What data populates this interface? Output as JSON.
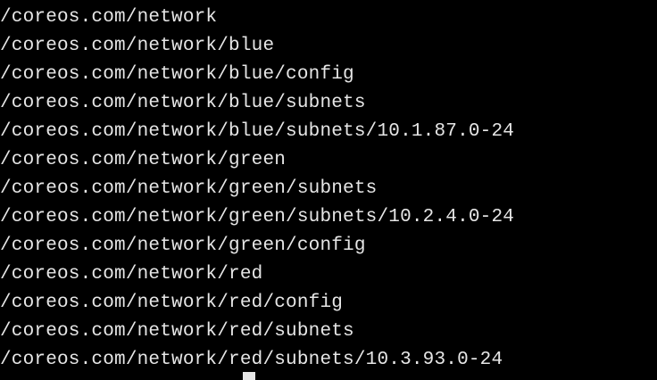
{
  "terminal": {
    "lines": [
      "/coreos.com/network",
      "/coreos.com/network/blue",
      "/coreos.com/network/blue/config",
      "/coreos.com/network/blue/subnets",
      "/coreos.com/network/blue/subnets/10.1.87.0-24",
      "/coreos.com/network/green",
      "/coreos.com/network/green/subnets",
      "/coreos.com/network/green/subnets/10.2.4.0-24",
      "/coreos.com/network/green/config",
      "/coreos.com/network/red",
      "/coreos.com/network/red/config",
      "/coreos.com/network/red/subnets",
      "/coreos.com/network/red/subnets/10.3.93.0-24"
    ],
    "background_color": "#000000",
    "text_color": "#e6e6e6"
  }
}
